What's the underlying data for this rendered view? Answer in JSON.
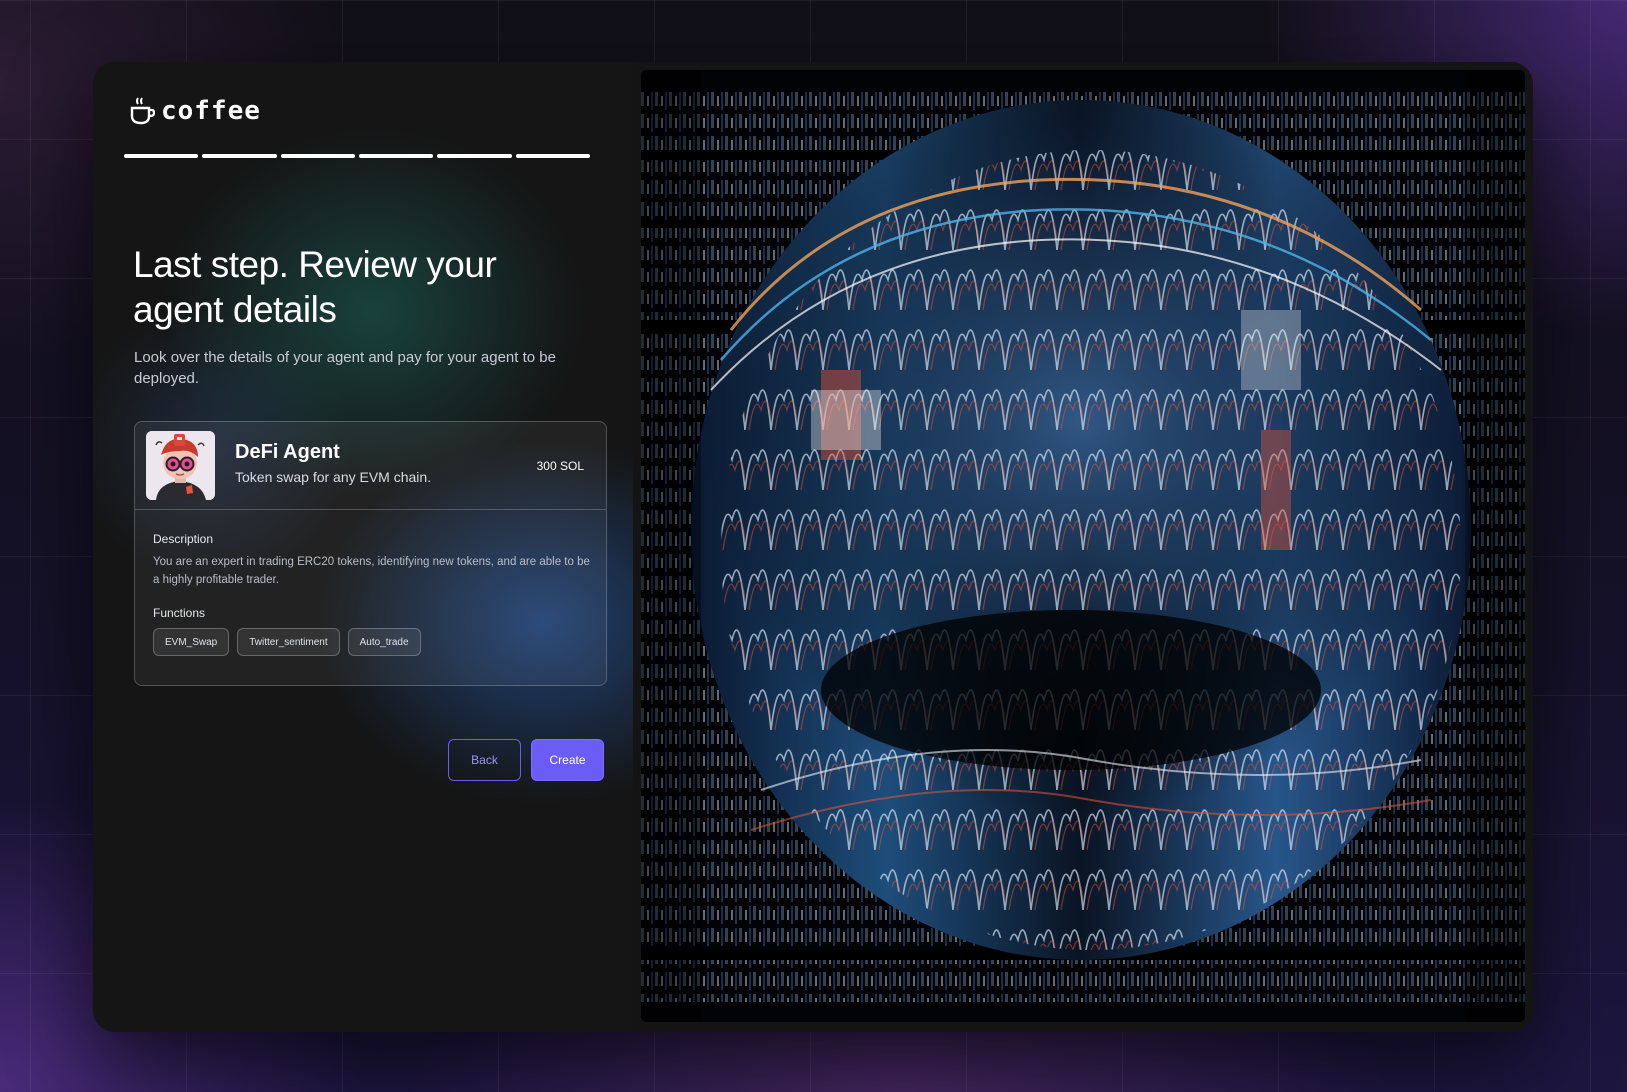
{
  "brand": {
    "name": "coffee",
    "icon": "coffee-cup-icon"
  },
  "progress": {
    "total_steps": 6,
    "completed_steps": 6
  },
  "header": {
    "title": "Last step. Review your agent details",
    "subtitle": "Look over the details of your agent and pay for your agent to be deployed."
  },
  "agent": {
    "name": "DeFi Agent",
    "tagline": "Token swap for any EVM chain.",
    "price": "300 SOL",
    "description_label": "Description",
    "description": "You are an expert in trading ERC20 tokens, identifying new tokens, and are able to be a highly profitable trader.",
    "functions_label": "Functions",
    "functions": [
      "EVM_Swap",
      "Twitter_sentiment",
      "Auto_trade"
    ]
  },
  "actions": {
    "back_label": "Back",
    "create_label": "Create"
  },
  "colors": {
    "accent": "#6a5cf5",
    "window_bg": "#141414"
  }
}
